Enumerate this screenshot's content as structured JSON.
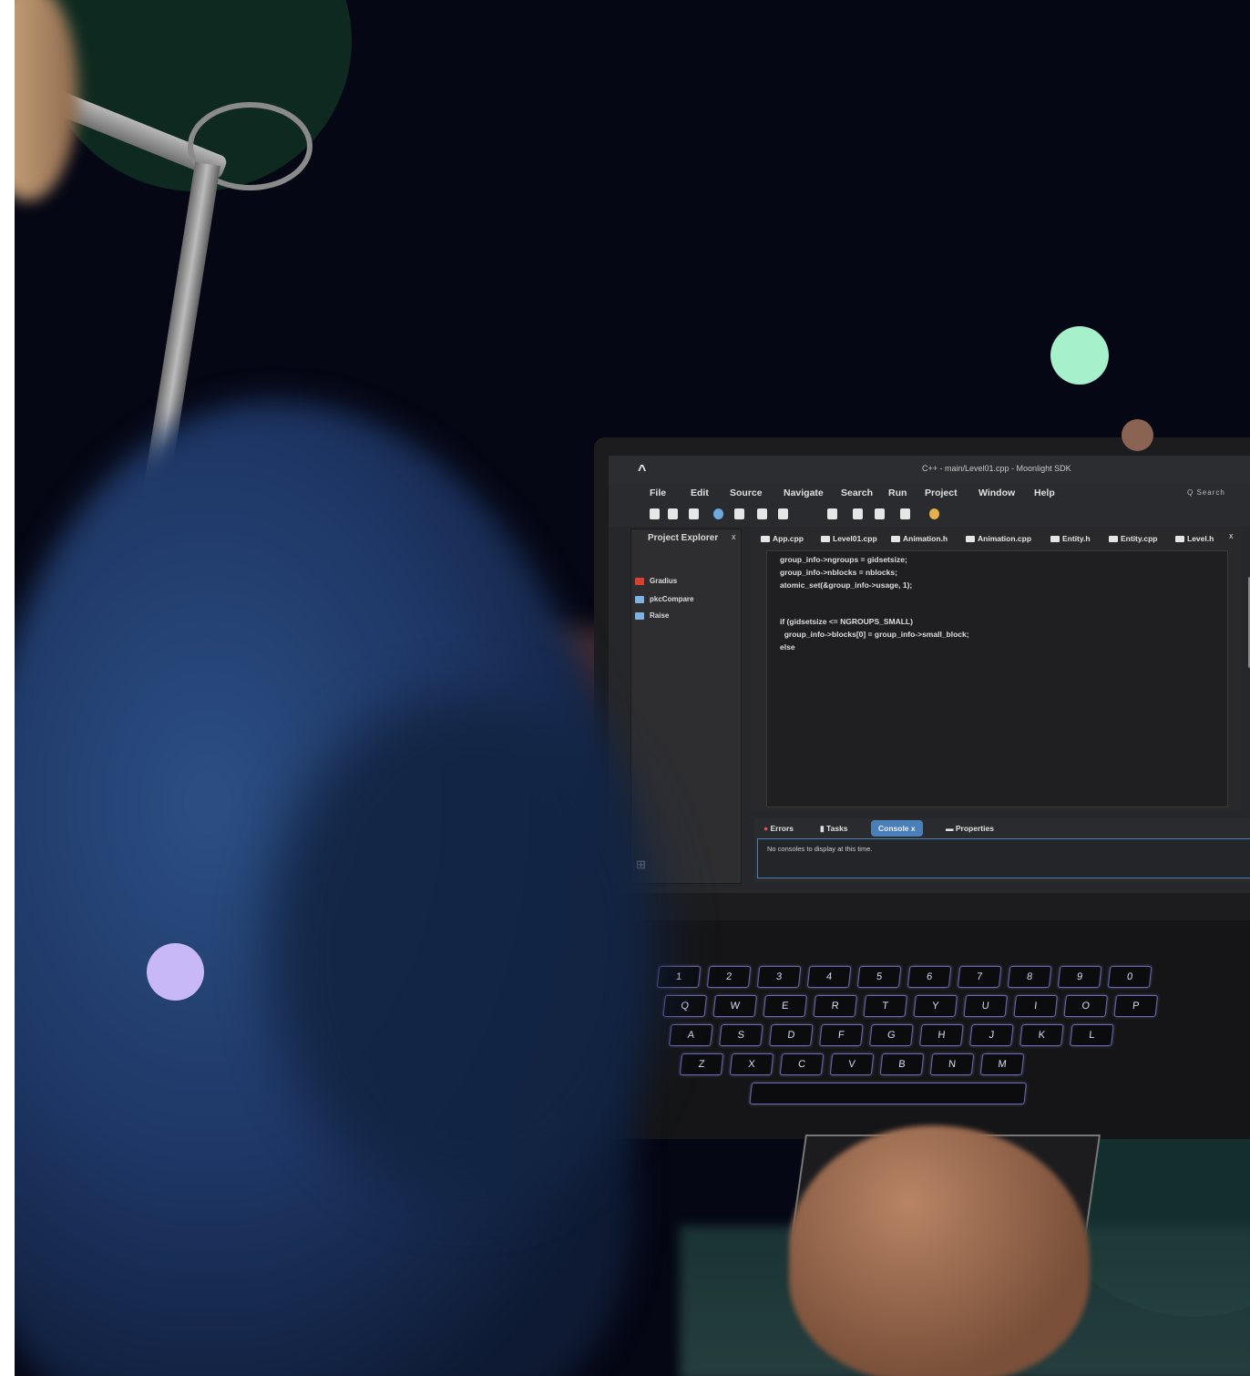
{
  "window": {
    "title": "C++ - main/Level01.cpp - Moonlight SDK",
    "logo": "^"
  },
  "menu": [
    "File",
    "Edit",
    "Source",
    "Navigate",
    "Search",
    "Run",
    "Project",
    "Window",
    "Help"
  ],
  "search_label": "Q Search",
  "explorer": {
    "title": "Project Explorer",
    "close": "x",
    "items": [
      "Gradius",
      "pkcCompare",
      "Raise"
    ]
  },
  "tabs": [
    "App.cpp",
    "Level01.cpp",
    "Animation.h",
    "Animation.cpp",
    "Entity.h",
    "Entity.cpp",
    "Level.h"
  ],
  "editor_close": "x",
  "code_lines": [
    "group_info->ngroups = gidsetsize;",
    "group_info->nblocks = nblocks;",
    "atomic_set(&group_info->usage, 1);",
    "",
    "if (gidsetsize <= NGROUPS_SMALL)",
    "  group_info->blocks[0] = group_info->small_block;",
    "else"
  ],
  "bottom_tabs": {
    "errors": "Errors",
    "tasks": "Tasks",
    "console": "Console",
    "console_close": "x",
    "properties": "Properties"
  },
  "console_message": "No consoles to display at this time.",
  "keyboard": {
    "row1": [
      "1",
      "2",
      "3",
      "4",
      "5",
      "6",
      "7",
      "8",
      "9",
      "0"
    ],
    "row2": [
      "Q",
      "W",
      "E",
      "R",
      "T",
      "Y",
      "U",
      "I",
      "O",
      "P"
    ],
    "row3": [
      "A",
      "S",
      "D",
      "F",
      "G",
      "H",
      "J",
      "K",
      "L"
    ],
    "row4": [
      "Z",
      "X",
      "C",
      "V",
      "B",
      "N",
      "M"
    ]
  },
  "colors": {
    "background": "#050714",
    "mint_dot": "#a6f0cc",
    "brown_dot": "#8a6353",
    "lavender_dot": "#c8b8f7",
    "console_tab": "#4b7fb8"
  }
}
